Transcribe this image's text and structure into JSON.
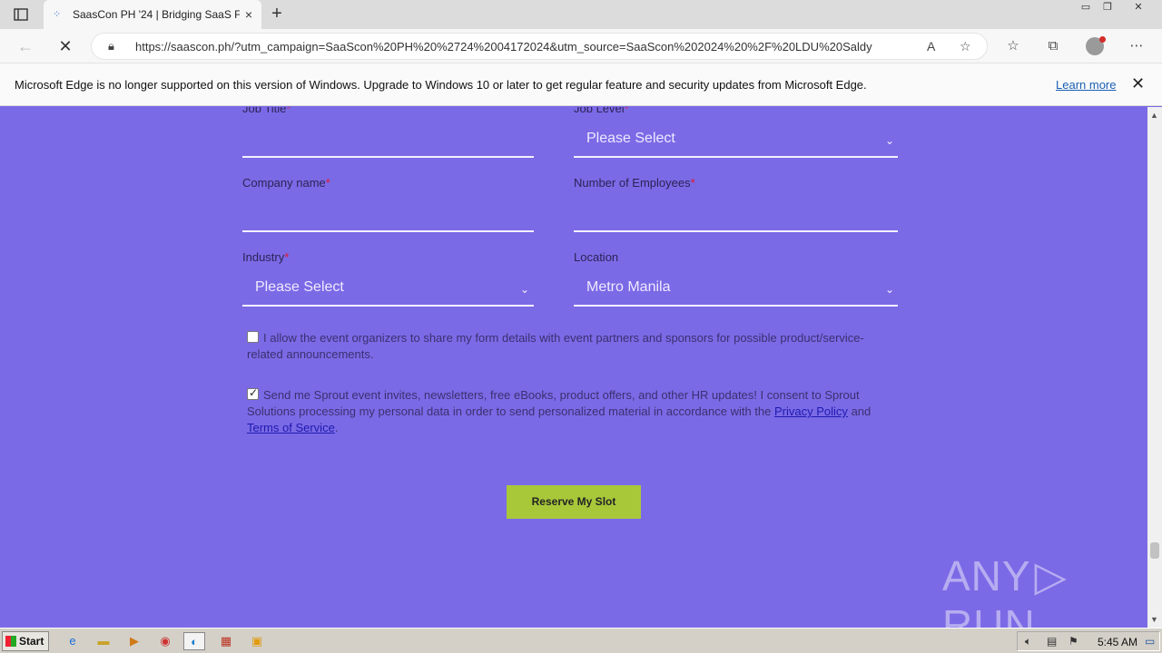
{
  "browser": {
    "tab_title": "SaasCon PH '24 | Bridging SaaS F",
    "tab_close": "×",
    "new_tab": "+",
    "url": "https://saascon.ph/?utm_campaign=SaaScon%20PH%20%2724%2004172024&utm_source=SaaScon%202024%20%2F%20LDU%20Saldy",
    "window_controls": [
      "▭",
      "❐",
      "✕"
    ]
  },
  "infobar": {
    "message": "Microsoft Edge is no longer supported on this version of Windows. Upgrade to Windows 10 or later to get regular feature and security updates from Microsoft Edge.",
    "learn_more": "Learn more",
    "close": "✕"
  },
  "form": {
    "job_title_label": "Job Title",
    "job_level_label": "Job Level",
    "job_level_value": "Please Select",
    "company_label": "Company name",
    "employees_label": "Number of Employees",
    "industry_label": "Industry",
    "industry_value": "Please Select",
    "location_label": "Location",
    "location_value": "Metro Manila",
    "required_mark": "*",
    "consent1_text": "I allow the event organizers to share my form details with event partners and sponsors for possible product/service-related announcements.",
    "consent1_checked": false,
    "consent2_text": "Send me Sprout event invites, newsletters, free eBooks, product offers, and other HR updates! I consent to Sprout Solutions processing my personal data in order to send personalized material in accordance with the",
    "consent2_checked": true,
    "privacy_link": "Privacy Policy",
    "and_text": "and",
    "terms_link": "Terms of Service",
    "period": ".",
    "submit_label": "Reserve My Slot"
  },
  "watermark": {
    "left": "ANY",
    "right": "RUN"
  },
  "taskbar": {
    "start_label": "Start",
    "clock": "5:45 AM"
  },
  "colors": {
    "page_bg": "#7b6ae6",
    "button_bg": "#a8c83a",
    "required": "#e0182d",
    "link": "#1e1ab0"
  }
}
